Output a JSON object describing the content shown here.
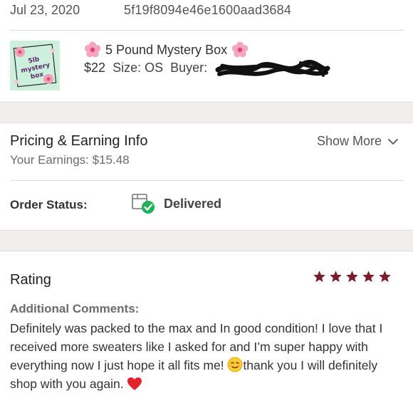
{
  "order": {
    "date": "Jul 23, 2020",
    "id": "5f19f8094e46e1600aad3684"
  },
  "item": {
    "thumbnail_text": "5lb mystery box",
    "title": "5 Pound Mystery Box",
    "title_emoji": "flower-emoji",
    "price": "$22",
    "size_label": "Size: OS",
    "buyer_label": "Buyer:",
    "buyer_value_redacted": true
  },
  "pricing": {
    "title": "Pricing & Earning Info",
    "earnings": "Your Earnings: $15.48",
    "show_more": "Show More"
  },
  "order_status": {
    "label": "Order Status:",
    "value": "Delivered",
    "icon": "package-delivered-icon",
    "status_color": "#1fb15a"
  },
  "rating": {
    "title": "Rating",
    "stars": 5,
    "max_stars": 5,
    "star_color": "#7a1c2c",
    "comments_heading": "Additional Comments:",
    "comment_part1": "Definitely was packed to the max and In good condition! I love that I received more sweaters like I asked for and I’m super happy with everything now I just hope it all fits me! ",
    "comment_part2": "thank you I will definitely shop with you again. "
  }
}
